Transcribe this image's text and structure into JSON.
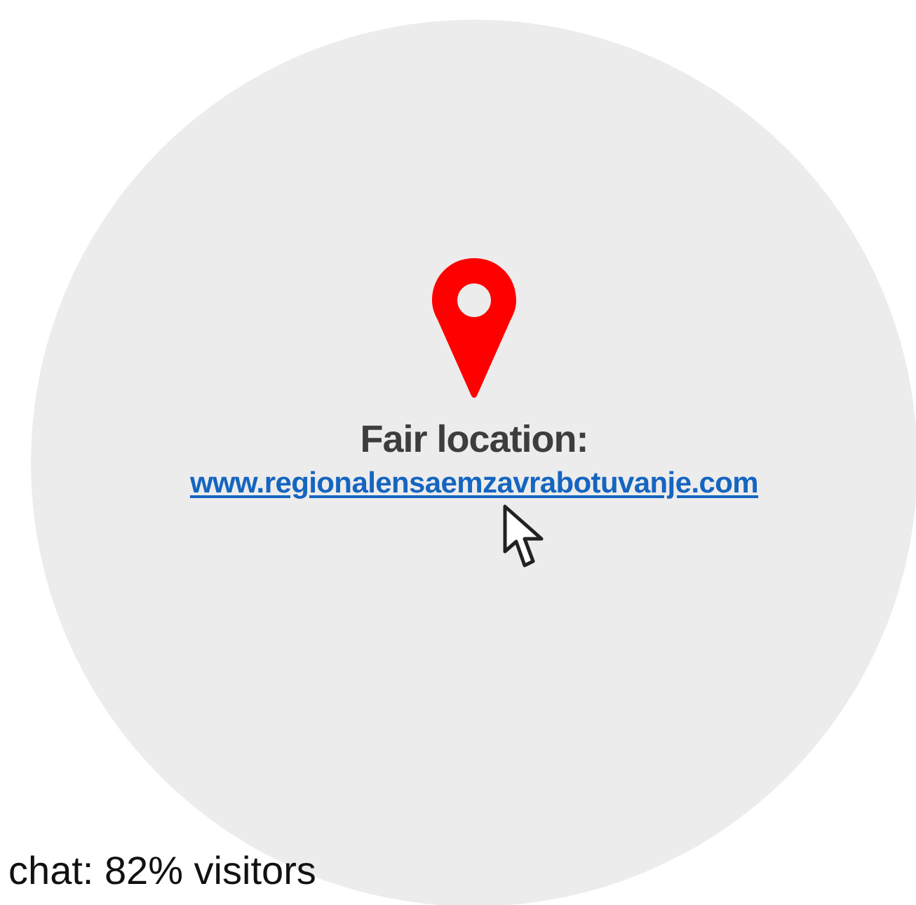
{
  "location": {
    "label": "Fair location:",
    "link": "www.regionalensaemzavrabotuvanje.com"
  },
  "footer_text": "chat: 82% visitors"
}
